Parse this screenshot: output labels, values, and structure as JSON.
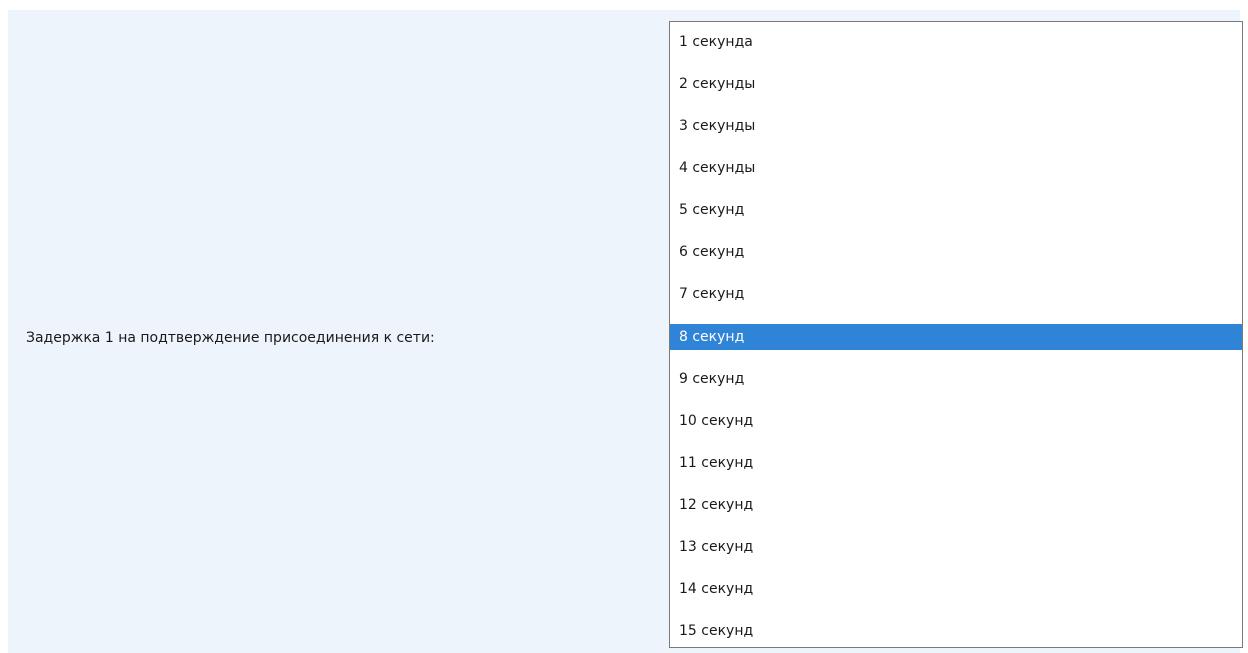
{
  "setting": {
    "label": "Задержка 1 на подтверждение присоединения к сети:"
  },
  "dropdown": {
    "selected_index": 7,
    "options": [
      "1 секунда",
      "2 секунды",
      "3 секунды",
      "4 секунды",
      "5 секунд",
      "6 секунд",
      "7 секунд",
      "8 секунд",
      "9 секунд",
      "10 секунд",
      "11 секунд",
      "12 секунд",
      "13 секунд",
      "14 секунд",
      "15 секунд"
    ]
  },
  "colors": {
    "row_background": "#eef4fc",
    "selection_background": "#3084d7",
    "selection_text": "#ffffff",
    "list_border": "#7a7a7a"
  }
}
